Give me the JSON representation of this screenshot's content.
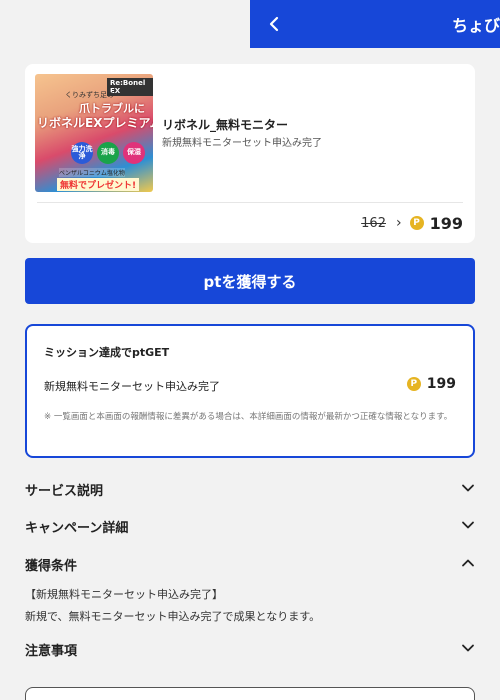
{
  "header": {
    "title": "ちょび",
    "back_icon": "chevron-left-icon",
    "color": "#1747d8"
  },
  "product": {
    "image": {
      "brand": "Re:Bonel EX",
      "catch1": "くりみずち足の",
      "catch2": "爪トラブルに",
      "headline": "リボネルEXプレミアム",
      "badge1": "強力洗浄",
      "badge2": "消毒",
      "badge3": "保湿",
      "small": "ベンザルコニウム塩化物",
      "promo": "無料でプレゼント!"
    },
    "name": "リボネル_無料モニター",
    "subtitle": "新規無料モニターセット申込み完了",
    "points_old": "162",
    "points_new": "199",
    "coin_label": "P"
  },
  "action": {
    "get_button": "ptを獲得する"
  },
  "mission": {
    "title": "ミッション達成でptGET",
    "item": "新規無料モニターセット申込み完了",
    "points": "199",
    "note": "※ 一覧画面と本画面の報酬情報に差異がある場合は、本詳細画面の情報が最新かつ正確な情報となります。"
  },
  "sections": {
    "service": "サービス説明",
    "campaign": "キャンペーン詳細",
    "conditions": "獲得条件",
    "conditions_line1": "【新規無料モニターセット申込み完了】",
    "conditions_line2": "新規で、無料モニターセット申込み完了で成果となります。",
    "notes": "注意事項"
  }
}
